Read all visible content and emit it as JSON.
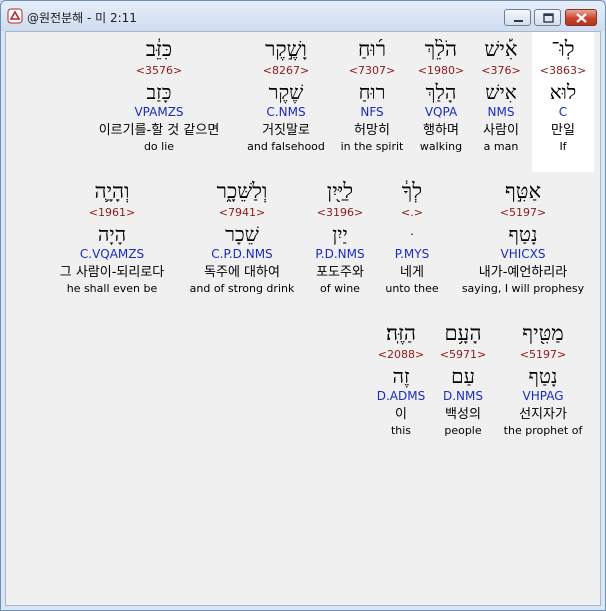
{
  "window": {
    "title": "@원전분해 - 미 2:11",
    "buttons": {
      "minimize": "minimize",
      "maximize": "maximize",
      "close": "close"
    }
  },
  "colors": {
    "strong_number": "#8b1a1a",
    "morphology": "#1a2bc2",
    "highlight": "#ffffff"
  },
  "rows": [
    {
      "words": [
        {
          "hebrew": "לֽוּ־",
          "strong": "<3863>",
          "lemma": "לוּא",
          "morph": "C",
          "korean": "만일",
          "english": "If",
          "highlighted": true
        },
        {
          "hebrew": "אִ֡ישׁ",
          "strong": "<376>",
          "lemma": "אִישׁ",
          "morph": "NMS",
          "korean": "사람이",
          "english": "a man"
        },
        {
          "hebrew": "הֹלֵ֨ךְ",
          "strong": "<1980>",
          "lemma": "הָלַךְ",
          "morph": "VQPA",
          "korean": "행하며",
          "english": "walking"
        },
        {
          "hebrew": "ר֜וּחַ",
          "strong": "<7307>",
          "lemma": "רוּחַ",
          "morph": "NFS",
          "korean": "허망히",
          "english": "in the spirit"
        },
        {
          "hebrew": "וָשֶׁ֣קֶר",
          "strong": "<8267>",
          "lemma": "שֶׁקֶר",
          "morph": "C.NMS",
          "korean": "거짓말로",
          "english": "and falsehood"
        },
        {
          "hebrew": "כִּזֵּ֔ב",
          "strong": "<3576>",
          "lemma": "כָּזַב",
          "morph": "VPAMZS",
          "korean": "이르기를-할 것 같으면",
          "english": "do lie"
        }
      ]
    },
    {
      "words": [
        {
          "hebrew": "אַטִּ֣ף",
          "strong": "<5197>",
          "lemma": "נָטַף",
          "morph": "VHICXS",
          "korean": "내가-예언하리라",
          "english": "saying, I will prophesy"
        },
        {
          "hebrew": "לְךָ֔",
          "strong": "<.>",
          "lemma": "ּ",
          "morph": "P.MYS",
          "korean": "네게",
          "english": "unto thee"
        },
        {
          "hebrew": "לַיַּ֖יִן",
          "strong": "<3196>",
          "lemma": "יַיִן",
          "morph": "P.D.NMS",
          "korean": "포도주와",
          "english": "of wine"
        },
        {
          "hebrew": "וְלַשֵּׁכָ֑ר",
          "strong": "<7941>",
          "lemma": "שֵׁכָר",
          "morph": "C.P.D.NMS",
          "korean": "독주에 대하여",
          "english": "and of strong drink"
        },
        {
          "hebrew": "וְהָיָ֛ה",
          "strong": "<1961>",
          "lemma": "הָיָה",
          "morph": "C.VQAMZS",
          "korean": "그 사람이-되리로다",
          "english": "he shall even be"
        }
      ]
    },
    {
      "words": [
        {
          "hebrew": "מַטִּ֖יף",
          "strong": "<5197>",
          "lemma": "נָטַף",
          "morph": "VHPAG",
          "korean": "선지자가",
          "english": "the prophet of"
        },
        {
          "hebrew": "הָעָ֥ם",
          "strong": "<5971>",
          "lemma": "עַם",
          "morph": "D.NMS",
          "korean": "백성의",
          "english": "people"
        },
        {
          "hebrew": "הַזֶּֽה׃",
          "strong": "<2088>",
          "lemma": "זֶה",
          "morph": "D.ADMS",
          "korean": "이",
          "english": "this"
        }
      ]
    }
  ]
}
